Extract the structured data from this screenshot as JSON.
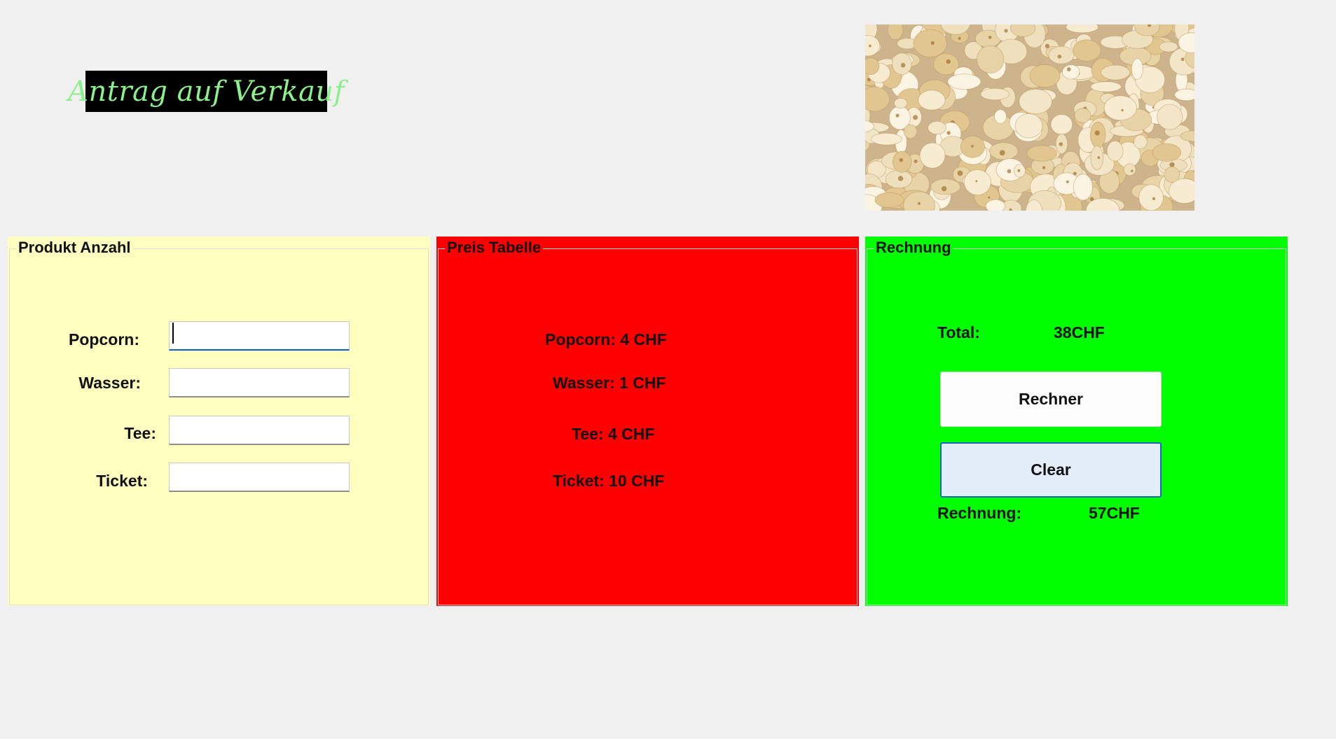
{
  "header": {
    "title": "Antrag auf Verkauf"
  },
  "product_panel": {
    "legend": "Produkt Anzahl",
    "fields": [
      {
        "label": "Popcorn:",
        "value": "",
        "focused": true
      },
      {
        "label": "Wasser:",
        "value": "",
        "focused": false
      },
      {
        "label": "Tee:",
        "value": "",
        "focused": false
      },
      {
        "label": "Ticket:",
        "value": "",
        "focused": false
      }
    ]
  },
  "price_panel": {
    "legend": "Preis Tabelle",
    "items": [
      "Popcorn: 4 CHF",
      "Wasser: 1 CHF",
      "Tee: 4 CHF",
      "Ticket: 10 CHF"
    ]
  },
  "bill_panel": {
    "legend": "Rechnung",
    "total_label": "Total:",
    "total_value": "38CHF",
    "calc_button": "Rechner",
    "clear_button": "Clear",
    "bill_label": "Rechnung:",
    "bill_value": "57CHF"
  },
  "colors": {
    "background": "#f0f0f0",
    "product_panel": "#ffffc0",
    "price_panel": "#ff0000",
    "bill_panel": "#00ff00",
    "title_text": "#8cf08c",
    "title_background": "#000000"
  },
  "image": {
    "icon": "popcorn-photo"
  }
}
